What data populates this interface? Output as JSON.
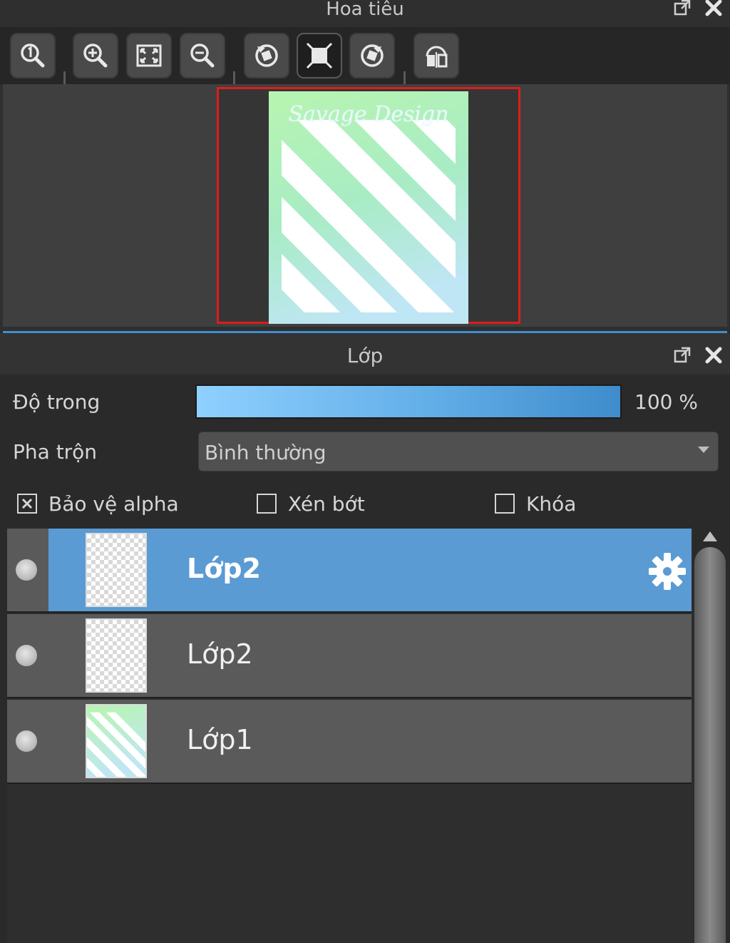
{
  "navigator": {
    "title": "Hoa tiêu",
    "toolbar": [
      {
        "icon": "zoom-actual-size-icon"
      },
      {
        "icon": "zoom-in-icon"
      },
      {
        "icon": "fit-to-window-icon"
      },
      {
        "icon": "zoom-out-icon"
      },
      {
        "icon": "rotate-left-icon"
      },
      {
        "icon": "reset-view-icon",
        "active": true
      },
      {
        "icon": "rotate-right-icon"
      },
      {
        "icon": "flip-horizontal-icon"
      }
    ],
    "thumbnail_text": "Savage Design",
    "view_frame_color": "#e01c1c"
  },
  "layers": {
    "title": "Lớp",
    "opacity_label": "Độ trong",
    "opacity_value": "100 %",
    "opacity_percent": 100,
    "blend_label": "Pha trộn",
    "blend_value": "Bình thường",
    "checkboxes": [
      {
        "label": "Bảo vệ alpha",
        "checked": true
      },
      {
        "label": "Xén bớt",
        "checked": false
      },
      {
        "label": "Khóa",
        "checked": false
      }
    ],
    "items": [
      {
        "name": "Lớp2",
        "selected": true,
        "thumb": "transparent"
      },
      {
        "name": "Lớp2",
        "selected": false,
        "thumb": "transparent"
      },
      {
        "name": "Lớp1",
        "selected": false,
        "thumb": "stripes"
      }
    ],
    "accent_color": "#5a9bd3"
  }
}
